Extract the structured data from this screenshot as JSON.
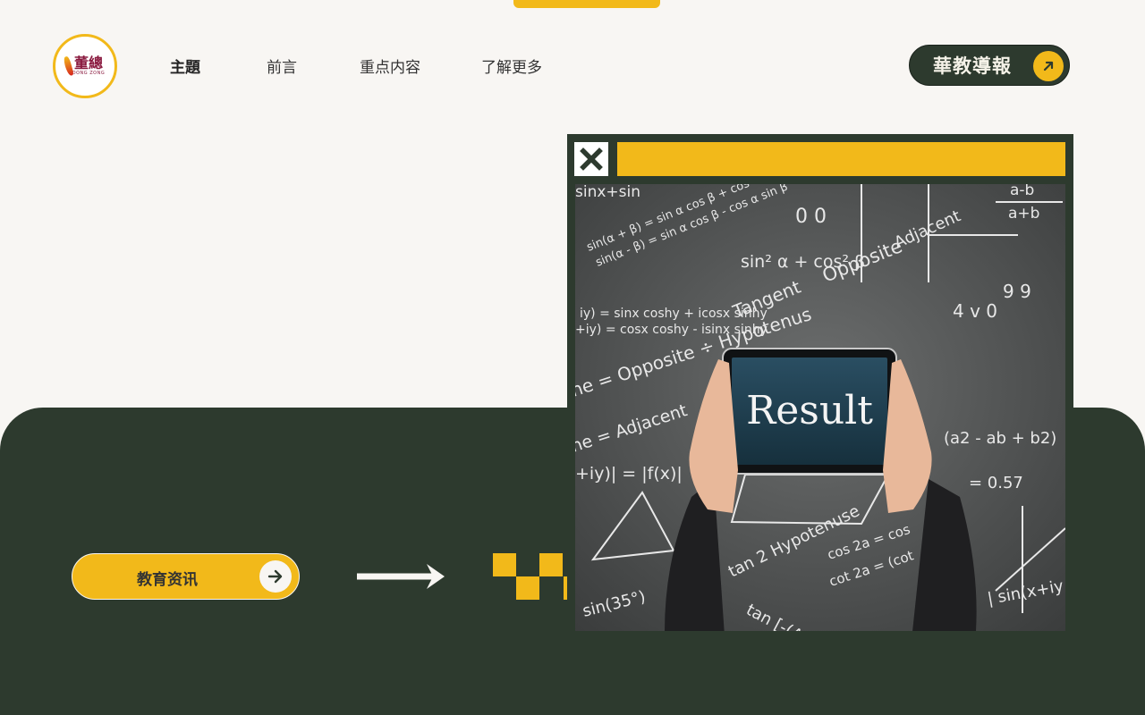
{
  "logo": {
    "cn": "董總",
    "en": "DONG ZONG"
  },
  "nav": [
    {
      "label": "主題",
      "active": true
    },
    {
      "label": "前言",
      "active": false
    },
    {
      "label": "重点内容",
      "active": false
    },
    {
      "label": "了解更多",
      "active": false
    }
  ],
  "header_cta": {
    "label": "華教導報",
    "icon": "arrow-up-right-icon"
  },
  "hero_button": {
    "label": "教育资讯",
    "icon": "arrow-right-icon"
  },
  "window_image": {
    "tablet_text": "Result",
    "board_text": {
      "a": "sinx+sin",
      "b": "a-b",
      "c": "a+b",
      "d": "sin² α + cos² β",
      "e": "Opposite",
      "f": "Adjacent",
      "g": "Tangent",
      "h": "Hypotenus",
      "i": "ne = Opposite ÷ Hypotenus",
      "j": "ne = Adjacent",
      "k": "+iy)| = |f(x)|",
      "l": "iy) = sinx coshy + icosx sinhy",
      "m": "+iy) = cosx coshy - isinx sinhy",
      "n": "(a2 - ab + b2)",
      "o": "= 0.57",
      "p": "tan 2 Hypotenuse",
      "q": "cos 2a = cos",
      "r": "cot 2a = (cot",
      "s": "tan [-(A-B)]",
      "t": "sin(35°)",
      "u": "| sin(x+iy",
      "v": "sin(α + β) = sin α cos β + cos α sin β",
      "w": "sin(α - β) = sin α cos β - cos α sin β",
      "x": "0 0",
      "y": "4 v 0",
      "z": "9 9"
    }
  },
  "colors": {
    "accent": "#f2b91a",
    "dark": "#2d3a2e",
    "background": "#f8f6f3"
  }
}
